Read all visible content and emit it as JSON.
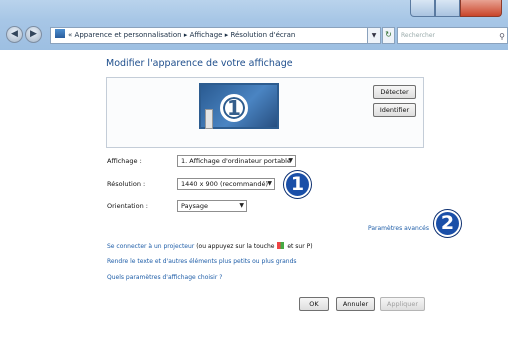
{
  "window": {
    "breadcrumb": {
      "prefix": "«",
      "item1": "Apparence et personnalisation",
      "item2": "Affichage",
      "item3": "Résolution d'écran",
      "sep": "▸"
    },
    "search_placeholder": "Rechercher"
  },
  "main": {
    "title": "Modifier l'apparence de votre affichage",
    "monitor_number": "1",
    "detect_label": "Détecter",
    "identify_label": "Identifier",
    "display_label": "Affichage :",
    "display_value": "1. Affichage d'ordinateur portable",
    "resolution_label": "Résolution :",
    "resolution_value": "1440 x 900 (recommandé)",
    "orientation_label": "Orientation :",
    "orientation_value": "Paysage",
    "advanced_link": "Paramètres avancés",
    "projector_link": "Se connecter à un projecteur",
    "projector_hint_1": "(ou appuyez sur la touche",
    "projector_hint_2": "et sur P)",
    "text_size_link": "Rendre le texte et d'autres éléments plus petits ou plus grands",
    "which_settings_link": "Quels paramètres d'affichage choisir ?",
    "ok_label": "OK",
    "cancel_label": "Annuler",
    "apply_label": "Appliquer"
  },
  "callouts": {
    "badge_1": "1",
    "badge_2": "2",
    "color": "#1a4fa8"
  },
  "icons": [
    "back-arrow-icon",
    "forward-arrow-icon",
    "control-panel-icon",
    "refresh-icon",
    "search-icon",
    "windows-key-icon"
  ]
}
